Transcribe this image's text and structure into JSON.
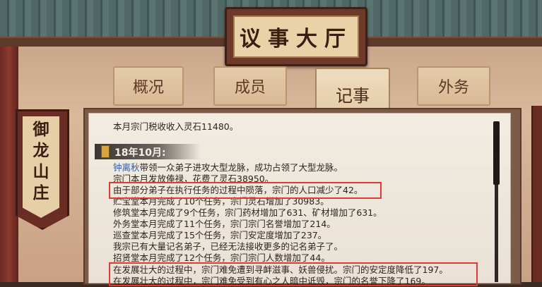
{
  "hall": {
    "title": "议事大厅"
  },
  "tabs": [
    {
      "label": "概况"
    },
    {
      "label": "成员"
    },
    {
      "label": "记事"
    },
    {
      "label": "外务"
    }
  ],
  "sect_banner": {
    "chars": [
      "御",
      "龙",
      "山",
      "庄"
    ]
  },
  "log": {
    "intro": "本月宗门税收收入灵石11480。",
    "date": "18年10月:",
    "name": "钟离秋",
    "entry_after_name": "带领一众弟子进攻大型龙脉，成功占领了大型龙脉。",
    "lines": [
      "宗门本月发放俸禄，花费了灵石38950。",
      "由于部分弟子在执行任务的过程中陨落，宗门的人口减少了42。",
      "贮宝堂本月完成了10个任务，宗门灵石增加了30983。",
      "修筑堂本月完成了9个任务，宗门药材增加了631、矿材增加了631。",
      "外务堂本月完成了11个任务，宗门宗门名誉增加了214。",
      "巡查堂本月完成了15个任务，宗门安定度增加了237。",
      "我宗已有大量记名弟子，已经无法接收更多的记名弟子了。",
      "招贤堂本月完成了12个任务，宗门宗门人数增加了44。",
      "在发展壮大的过程中，宗门难免遭到寻衅滋事、妖兽侵扰。宗门的安定度降低了197。",
      "在发展壮大的过程中，宗门难免受到有心之人暗中诋毁，宗门的名誉下降了169。"
    ]
  },
  "colors": {
    "highlight": "#e03a32",
    "name_link": "#2f5ea8"
  }
}
